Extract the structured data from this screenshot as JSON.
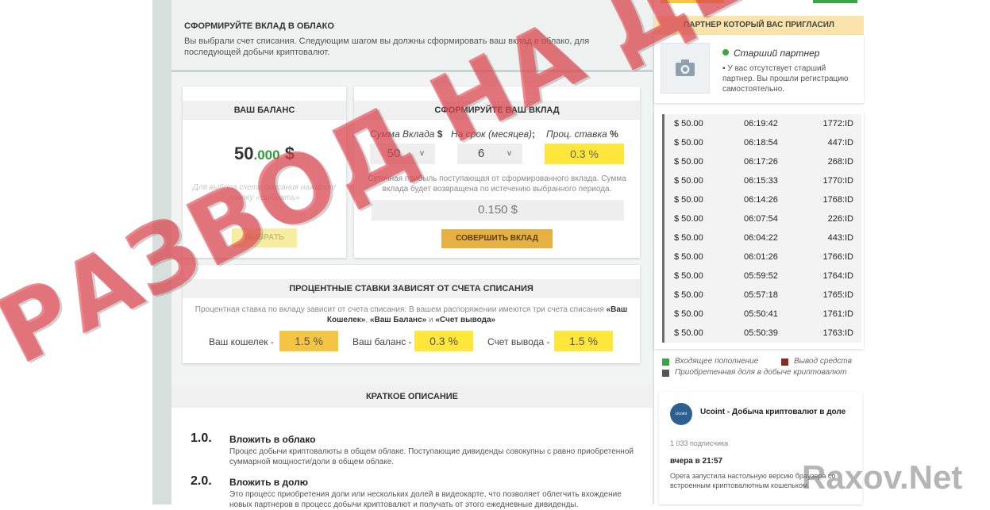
{
  "header": {
    "title": "СФОРМИРУЙТЕ ВКЛАД В ОБЛАКО",
    "description": "Вы выбрали счет списания. Следующим шагом вы должны сформировать ваш вклад в облако, для последующей добычи криптовалют."
  },
  "balance_card": {
    "title": "ВАШ БАЛАНС",
    "amount_int": "50",
    "amount_dec": ".000",
    "currency": "$",
    "hint": "Для выбора счета списания нажмите кнопку «Выбрать»",
    "button": "ВЫБРАТЬ"
  },
  "deposit_card": {
    "title": "СФОРМИРУЙТЕ ВАШ ВКЛАД",
    "sum_label": "Сумма Вклада",
    "sum_unit": "$",
    "sum_value": "50",
    "term_label": "На срок (месяцев)",
    "term_unit": ";",
    "term_value": "6",
    "rate_label": "Проц. ставка",
    "rate_unit": "%",
    "rate_value": "0.3 %",
    "chevron": "v",
    "daily_text": "Суточная прибыль поступающая от сформированного вклада. Сумма вклада будет возвращена по истечению выбранного периода.",
    "daily_profit": "0.150 $",
    "submit": "СОВЕРШИТЬ ВКЛАД"
  },
  "rates_card": {
    "title": "ПРОЦЕНТНЫЕ СТАВКИ ЗАВИСЯТ ОТ СЧЕТА СПИСАНИЯ",
    "text_plain": "Процентная ставка по вкладу зависит от счета списания: В вашем распоряжении имеются три счета списания ",
    "acc1": "«Ваш Кошелек»",
    "comma": ", ",
    "acc2": "«Ваш Баланс»",
    "and": " и ",
    "acc3": "«Счет вывода»",
    "wallet_label": "Ваш кошелек -",
    "wallet_rate": "1.5 %",
    "balance_label": "Ваш баланс -",
    "balance_rate": "0.3 %",
    "withdraw_label": "Счет вывода -",
    "withdraw_rate": "1.5 %"
  },
  "description": {
    "title": "КРАТКОЕ ОПИСАНИЕ",
    "steps": [
      {
        "num": "1.0.",
        "title": "Вложить в облако",
        "text": "Процес добычи криптовалюты в общем облаке. Поступающие дивиденды совокупны с равно приобретенной суммарной мощности/доли в общем облаке."
      },
      {
        "num": "2.0.",
        "title": "Вложить в долю",
        "text": "Это процесс приобретения доли или нескольких долей в видеокарте, что позволяет облегчить вхождение новых партнеров в процесс добычи криптовалют и получать от этого ежедневные дивиденды."
      }
    ]
  },
  "partner": {
    "title": "ПАРТНЕР КОТОРЫЙ ВАС ПРИГЛАСИЛ",
    "name": "Старший партнер",
    "bullet": "▪",
    "text": "У вас отсутствует старший партнер. Вы прошли регистрацию самостоятельно."
  },
  "feed": [
    {
      "amount": "$ 50.00",
      "time": "06:19:42",
      "id": "1772:ID"
    },
    {
      "amount": "$ 50.00",
      "time": "06:18:54",
      "id": "447:ID"
    },
    {
      "amount": "$ 50.00",
      "time": "06:17:26",
      "id": "268:ID"
    },
    {
      "amount": "$ 50.00",
      "time": "06:15:33",
      "id": "1770:ID"
    },
    {
      "amount": "$ 50.00",
      "time": "06:14:26",
      "id": "1768:ID"
    },
    {
      "amount": "$ 50.00",
      "time": "06:07:54",
      "id": "226:ID"
    },
    {
      "amount": "$ 50.00",
      "time": "06:04:22",
      "id": "443:ID"
    },
    {
      "amount": "$ 50.00",
      "time": "06:01:26",
      "id": "1766:ID"
    },
    {
      "amount": "$ 50.00",
      "time": "05:59:52",
      "id": "1764:ID"
    },
    {
      "amount": "$ 50.00",
      "time": "05:57:18",
      "id": "1765:ID"
    },
    {
      "amount": "$ 50.00",
      "time": "05:50:41",
      "id": "1761:ID"
    },
    {
      "amount": "$ 50.00",
      "time": "05:50:39",
      "id": "1763:ID"
    }
  ],
  "legend": {
    "incoming": "Входящее пополнение",
    "withdraw": "Вывод средств",
    "share": "Приобретенная доля в добыче криптовалют",
    "colors": {
      "incoming": "#3aa447",
      "withdraw": "#8a2b1f",
      "share": "#555555"
    }
  },
  "telegram": {
    "avatar_text": "Ucoint",
    "title": "Ucoint - Добыча криптовалют в доле",
    "subscribers": "1 033 подписчика",
    "time": "вчера в 21:57",
    "text": "Opera запустила настольную версию браузера со встроенным криптовалютным кошельком."
  },
  "watermark": "РАЗВОД НА ДЕНЬГИ",
  "site_mark": "Raxov.Net",
  "colors": {
    "yellow": "#ffe63a",
    "orange": "#f4c542",
    "submit": "#e7b043",
    "green": "#2e9b3c"
  }
}
